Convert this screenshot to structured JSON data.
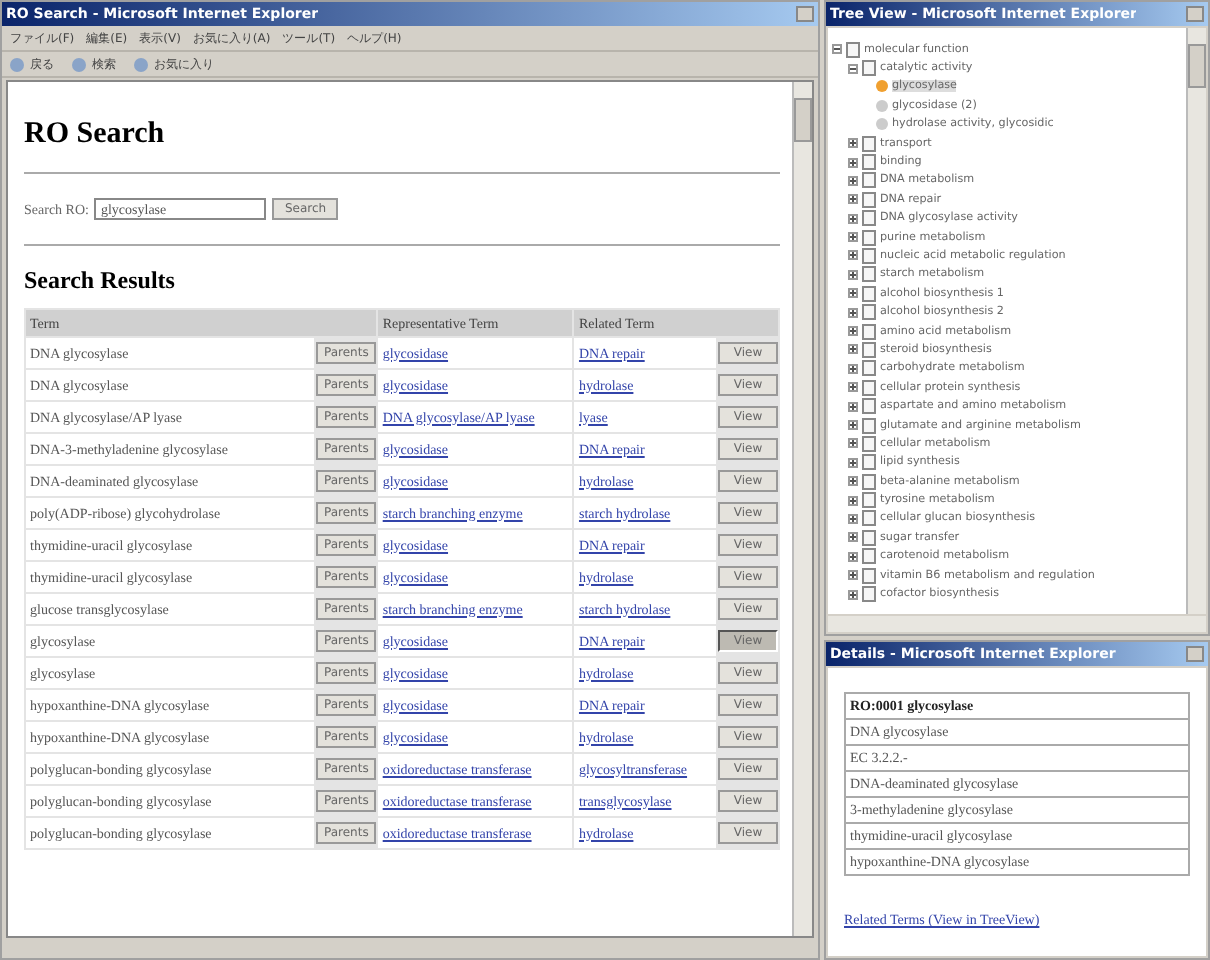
{
  "browser": {
    "title": "RO Search - Microsoft Internet Explorer",
    "menu": [
      "ファイル(F)",
      "編集(E)",
      "表示(V)",
      "お気に入り(A)",
      "ツール(T)",
      "ヘルプ(H)"
    ],
    "toolbar": [
      "戻る",
      "検索",
      "お気に入り"
    ]
  },
  "page": {
    "heading": "RO Search",
    "search": {
      "label": "Search RO:",
      "value": "glycosylase",
      "button": "Search"
    },
    "results_heading": "Search Results",
    "columns": [
      "Term",
      "Representative Term",
      "Related Term"
    ],
    "rows": [
      {
        "term": "DNA glycosylase",
        "button": "Parents",
        "representative": "glycosidase",
        "related": "DNA repair",
        "view": "View",
        "selected": false
      },
      {
        "term": "DNA glycosylase",
        "button": "Parents",
        "representative": "glycosidase",
        "related": "hydrolase",
        "view": "View",
        "selected": false
      },
      {
        "term": "DNA glycosylase/AP lyase",
        "button": "Parents",
        "representative": "DNA glycosylase/AP lyase",
        "related": "lyase",
        "view": "View",
        "selected": false
      },
      {
        "term": "DNA-3-methyladenine glycosylase",
        "button": "Parents",
        "representative": "glycosidase",
        "related": "DNA repair",
        "view": "View",
        "selected": false
      },
      {
        "term": "DNA-deaminated glycosylase",
        "button": "Parents",
        "representative": "glycosidase",
        "related": "hydrolase",
        "view": "View",
        "selected": false
      },
      {
        "term": "poly(ADP-ribose) glycohydrolase",
        "button": "Parents",
        "representative": "starch branching enzyme",
        "related": "starch hydrolase",
        "view": "View",
        "selected": false
      },
      {
        "term": "thymidine-uracil glycosylase",
        "button": "Parents",
        "representative": "glycosidase",
        "related": "DNA repair",
        "view": "View",
        "selected": false
      },
      {
        "term": "thymidine-uracil glycosylase",
        "button": "Parents",
        "representative": "glycosidase",
        "related": "hydrolase",
        "view": "View",
        "selected": false
      },
      {
        "term": "glucose transglycosylase",
        "button": "Parents",
        "representative": "starch branching enzyme",
        "related": "starch hydrolase",
        "view": "View",
        "selected": false
      },
      {
        "term": "glycosylase",
        "button": "Parents",
        "representative": "glycosidase",
        "related": "DNA repair",
        "view": "View",
        "selected": true
      },
      {
        "term": "glycosylase",
        "button": "Parents",
        "representative": "glycosidase",
        "related": "hydrolase",
        "view": "View",
        "selected": false
      },
      {
        "term": "hypoxanthine-DNA glycosylase",
        "button": "Parents",
        "representative": "glycosidase",
        "related": "DNA repair",
        "view": "View",
        "selected": false
      },
      {
        "term": "hypoxanthine-DNA glycosylase",
        "button": "Parents",
        "representative": "glycosidase",
        "related": "hydrolase",
        "view": "View",
        "selected": false
      },
      {
        "term": "polyglucan-bonding glycosylase",
        "button": "Parents",
        "representative": "oxidoreductase transferase",
        "related": "glycosyltransferase",
        "view": "View",
        "selected": false
      },
      {
        "term": "polyglucan-bonding glycosylase",
        "button": "Parents",
        "representative": "oxidoreductase transferase",
        "related": "transglycosylase",
        "view": "View",
        "selected": false
      },
      {
        "term": "polyglucan-bonding glycosylase",
        "button": "Parents",
        "representative": "oxidoreductase transferase",
        "related": "hydrolase",
        "view": "View",
        "selected": false
      }
    ]
  },
  "tree_window": {
    "title": "Tree View - Microsoft Internet Explorer",
    "tree": [
      {
        "label": "molecular function",
        "expanded": true,
        "children": [
          {
            "label": "catalytic activity",
            "expanded": true,
            "children": [
              {
                "label": "glycosylase",
                "selected": true
              },
              {
                "label": "glycosidase (2)",
                "selected": false
              },
              {
                "label": "hydrolase activity, glycosidic",
                "selected": false
              }
            ]
          },
          {
            "label": "transport",
            "expanded": false
          },
          {
            "label": "binding",
            "expanded": false
          },
          {
            "label": "DNA metabolism",
            "expanded": false
          },
          {
            "label": "DNA repair",
            "expanded": false
          },
          {
            "label": "DNA glycosylase activity",
            "expanded": false
          },
          {
            "label": "purine metabolism",
            "expanded": false
          },
          {
            "label": "nucleic acid metabolic regulation",
            "expanded": false
          },
          {
            "label": "starch metabolism",
            "expanded": false
          },
          {
            "label": "alcohol biosynthesis 1",
            "expanded": false
          },
          {
            "label": "alcohol biosynthesis 2",
            "expanded": false
          },
          {
            "label": "amino acid metabolism",
            "expanded": false
          },
          {
            "label": "steroid biosynthesis",
            "expanded": false
          },
          {
            "label": "carbohydrate metabolism",
            "expanded": false
          },
          {
            "label": "cellular protein synthesis",
            "expanded": false
          },
          {
            "label": "aspartate and amino metabolism",
            "expanded": false
          },
          {
            "label": "glutamate and arginine metabolism",
            "expanded": false
          },
          {
            "label": "cellular metabolism",
            "expanded": false
          },
          {
            "label": "lipid synthesis",
            "expanded": false
          },
          {
            "label": "beta-alanine metabolism",
            "expanded": false
          },
          {
            "label": "tyrosine metabolism",
            "expanded": false
          },
          {
            "label": "cellular glucan biosynthesis",
            "expanded": false
          },
          {
            "label": "sugar transfer",
            "expanded": false
          },
          {
            "label": "carotenoid metabolism",
            "expanded": false
          },
          {
            "label": "vitamin B6 metabolism and regulation",
            "expanded": false
          },
          {
            "label": "cofactor biosynthesis",
            "expanded": false
          }
        ]
      }
    ]
  },
  "detail_window": {
    "title": "Details - Microsoft Internet Explorer",
    "rows": [
      "RO:0001 glycosylase",
      "DNA glycosylase",
      "EC 3.2.2.-",
      "DNA-deaminated glycosylase",
      "3-methyladenine glycosylase",
      "thymidine-uracil glycosylase",
      "hypoxanthine-DNA glycosylase"
    ],
    "link": "Related Terms (View in TreeView)"
  }
}
